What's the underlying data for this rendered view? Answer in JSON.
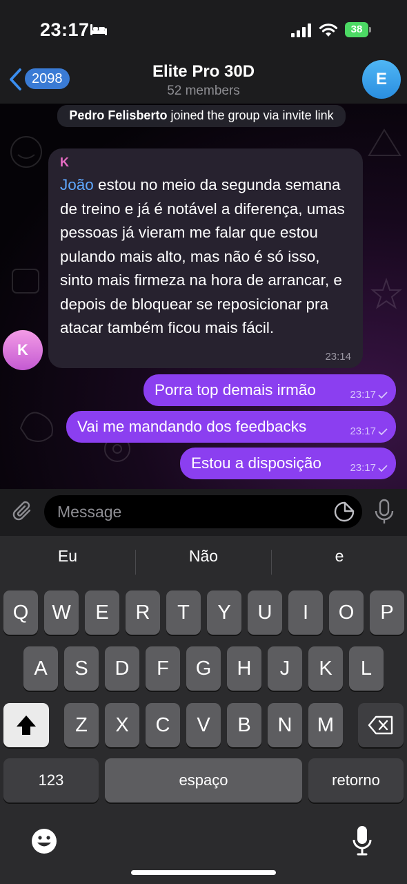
{
  "status_bar": {
    "time": "23:17",
    "battery": "38",
    "icons": [
      "bed-icon",
      "signal-icon",
      "wifi-icon",
      "battery-icon"
    ]
  },
  "header": {
    "back_count": "2098",
    "title": "Elite Pro 30D",
    "subtitle": "52 members",
    "avatar_letter": "E",
    "avatar_color": "#3d9fe8"
  },
  "chat": {
    "system_message": {
      "name": "Pedro Felisberto",
      "text": " joined the group via invite link"
    },
    "incoming": {
      "sender": "K",
      "avatar_letter": "K",
      "avatar_color": "#d977dc",
      "mention": "João",
      "text": " estou no meio da segunda semana de treino e já é notável a diferença, umas pessoas já vieram me falar que estou pulando mais alto, mas não é só isso, sinto mais firmeza na hora de arrancar, e depois de bloquear se reposicionar pra atacar também ficou mais fácil.",
      "time": "23:14"
    },
    "outgoing": [
      {
        "text": "Porra top demais irmão",
        "time": "23:17"
      },
      {
        "text": "Vai me mandando dos feedbacks",
        "time": "23:17"
      },
      {
        "text": "Estou a disposição",
        "time": "23:17"
      }
    ],
    "bubble_color": "#8b3ff0"
  },
  "composer": {
    "placeholder": "Message"
  },
  "keyboard": {
    "suggestions": [
      "Eu",
      "Não",
      "e"
    ],
    "row1": [
      "Q",
      "W",
      "E",
      "R",
      "T",
      "Y",
      "U",
      "I",
      "O",
      "P"
    ],
    "row2": [
      "A",
      "S",
      "D",
      "F",
      "G",
      "H",
      "J",
      "K",
      "L"
    ],
    "row3": [
      "Z",
      "X",
      "C",
      "V",
      "B",
      "N",
      "M"
    ],
    "numbers_key": "123",
    "space_key": "espaço",
    "return_key": "retorno"
  }
}
